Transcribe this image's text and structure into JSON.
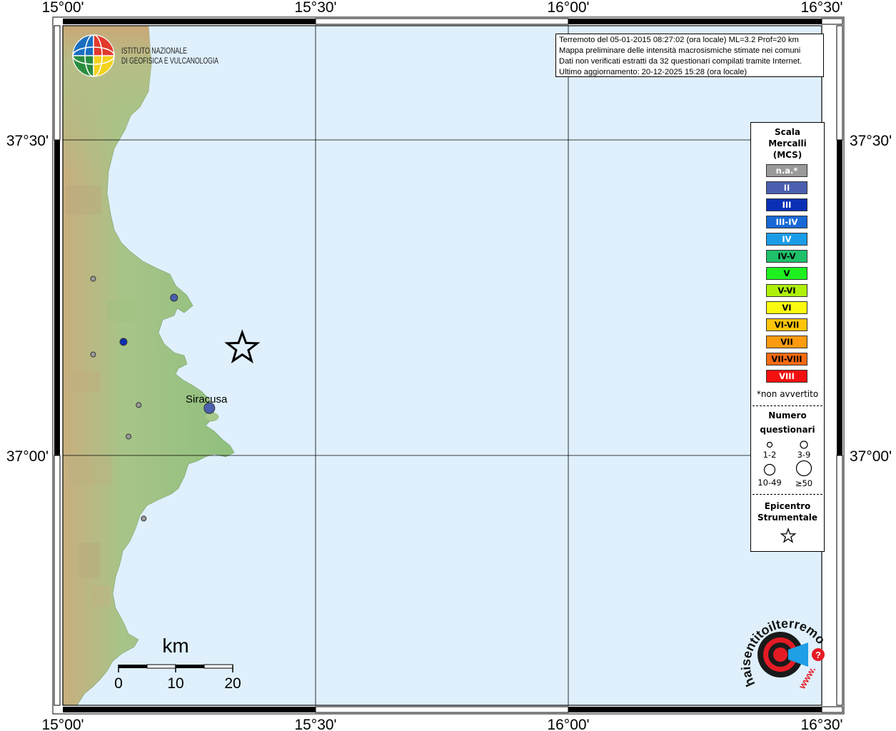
{
  "axes": {
    "lon_labels": [
      "15°00'",
      "15°30'",
      "16°00'",
      "16°30'"
    ],
    "lat_labels": [
      "37°30'",
      "37°00'"
    ]
  },
  "institute": {
    "line1": "ISTITUTO NAZIONALE",
    "line2": "DI GEOFISICA E VULCANOLOGIA"
  },
  "info": {
    "line1": "Terremoto del 05-01-2015 08:27:02 (ora locale) ML=3.2 Prof=20 km",
    "line2": "Mappa preliminare delle intensità macrosismiche stimate nei comuni",
    "line3": "Dati non verificati estratti da 32 questionari compilati tramite Internet.",
    "line4": "Ultimo aggiornamento: 20-12-2025 15:28 (ora locale)"
  },
  "city": {
    "name": "Siracusa"
  },
  "scale_bar": {
    "unit": "km",
    "ticks": [
      "0",
      "10",
      "20"
    ]
  },
  "legend": {
    "title_lines": [
      "Scala",
      "Mercalli",
      "(MCS)"
    ],
    "classes": [
      {
        "label": "n.a.*",
        "color": "#9a9a9a",
        "text": "#ffffff"
      },
      {
        "label": "II",
        "color": "#4a5fb0",
        "text": "#ffffff"
      },
      {
        "label": "III",
        "color": "#0a2fb5",
        "text": "#ffffff"
      },
      {
        "label": "III-IV",
        "color": "#1868d6",
        "text": "#ffffff"
      },
      {
        "label": "IV",
        "color": "#1a9ce8",
        "text": "#ffffff"
      },
      {
        "label": "IV-V",
        "color": "#1ec06a",
        "text": "#000000"
      },
      {
        "label": "V",
        "color": "#1ef020",
        "text": "#000000"
      },
      {
        "label": "V-VI",
        "color": "#aef00a",
        "text": "#000000"
      },
      {
        "label": "VI",
        "color": "#fafa10",
        "text": "#000000"
      },
      {
        "label": "VI-VII",
        "color": "#fcc40a",
        "text": "#000000"
      },
      {
        "label": "VII",
        "color": "#fc9a10",
        "text": "#000000"
      },
      {
        "label": "VII-VIII",
        "color": "#f86a12",
        "text": "#000000"
      },
      {
        "label": "VIII",
        "color": "#f21010",
        "text": "#ffffff"
      }
    ],
    "note": "*non avvertito",
    "count_title_lines": [
      "Numero",
      "questionari"
    ],
    "count_classes": [
      "1-2",
      "3-9",
      "10-49",
      "≥50"
    ],
    "epicenter_title_lines": [
      "Epicentro",
      "Strumentale"
    ]
  },
  "brand": {
    "text": "haisentitoilterremoto.it",
    "url": "www."
  },
  "colors": {
    "sea": "#dff0fc",
    "land": "#a9c889",
    "star": "#000000"
  },
  "observations": [
    {
      "lon": 15.06,
      "lat": 37.28,
      "class": "n.a.*",
      "count": "1-2"
    },
    {
      "lon": 15.22,
      "lat": 37.25,
      "class": "II",
      "count": "3-9"
    },
    {
      "lon": 15.12,
      "lat": 37.18,
      "class": "III",
      "count": "3-9"
    },
    {
      "lon": 15.06,
      "lat": 37.16,
      "class": "n.a.*",
      "count": "1-2"
    },
    {
      "lon": 15.15,
      "lat": 37.08,
      "class": "n.a.*",
      "count": "1-2"
    },
    {
      "lon": 15.29,
      "lat": 37.075,
      "class": "II",
      "count": "10-49"
    },
    {
      "lon": 15.13,
      "lat": 37.03,
      "class": "n.a.*",
      "count": "1-2"
    },
    {
      "lon": 15.16,
      "lat": 36.9,
      "class": "n.a.*",
      "count": "1-2"
    }
  ],
  "epicenter": {
    "lon": 15.355,
    "lat": 37.17
  }
}
